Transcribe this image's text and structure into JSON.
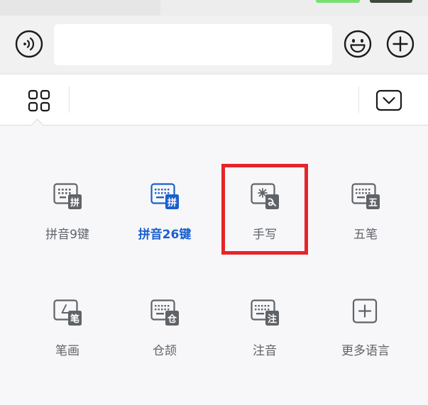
{
  "input_bar": {
    "message_value": ""
  },
  "keyboard_panel": {
    "items": [
      {
        "label": "拼音9键",
        "badge": "拼",
        "active": false
      },
      {
        "label": "拼音26键",
        "badge": "拼",
        "active": true
      },
      {
        "label": "手写",
        "badge": "",
        "active": false
      },
      {
        "label": "五笔",
        "badge": "五",
        "active": false
      },
      {
        "label": "笔画",
        "badge": "笔",
        "active": false
      },
      {
        "label": "仓颉",
        "badge": "仓",
        "active": false
      },
      {
        "label": "注音",
        "badge": "注",
        "active": false
      },
      {
        "label": "更多语言",
        "badge": "",
        "active": false
      }
    ]
  },
  "colors": {
    "accent": "#1b5fcf",
    "icon_gray": "#5f6369",
    "highlight": "#e5252a"
  }
}
